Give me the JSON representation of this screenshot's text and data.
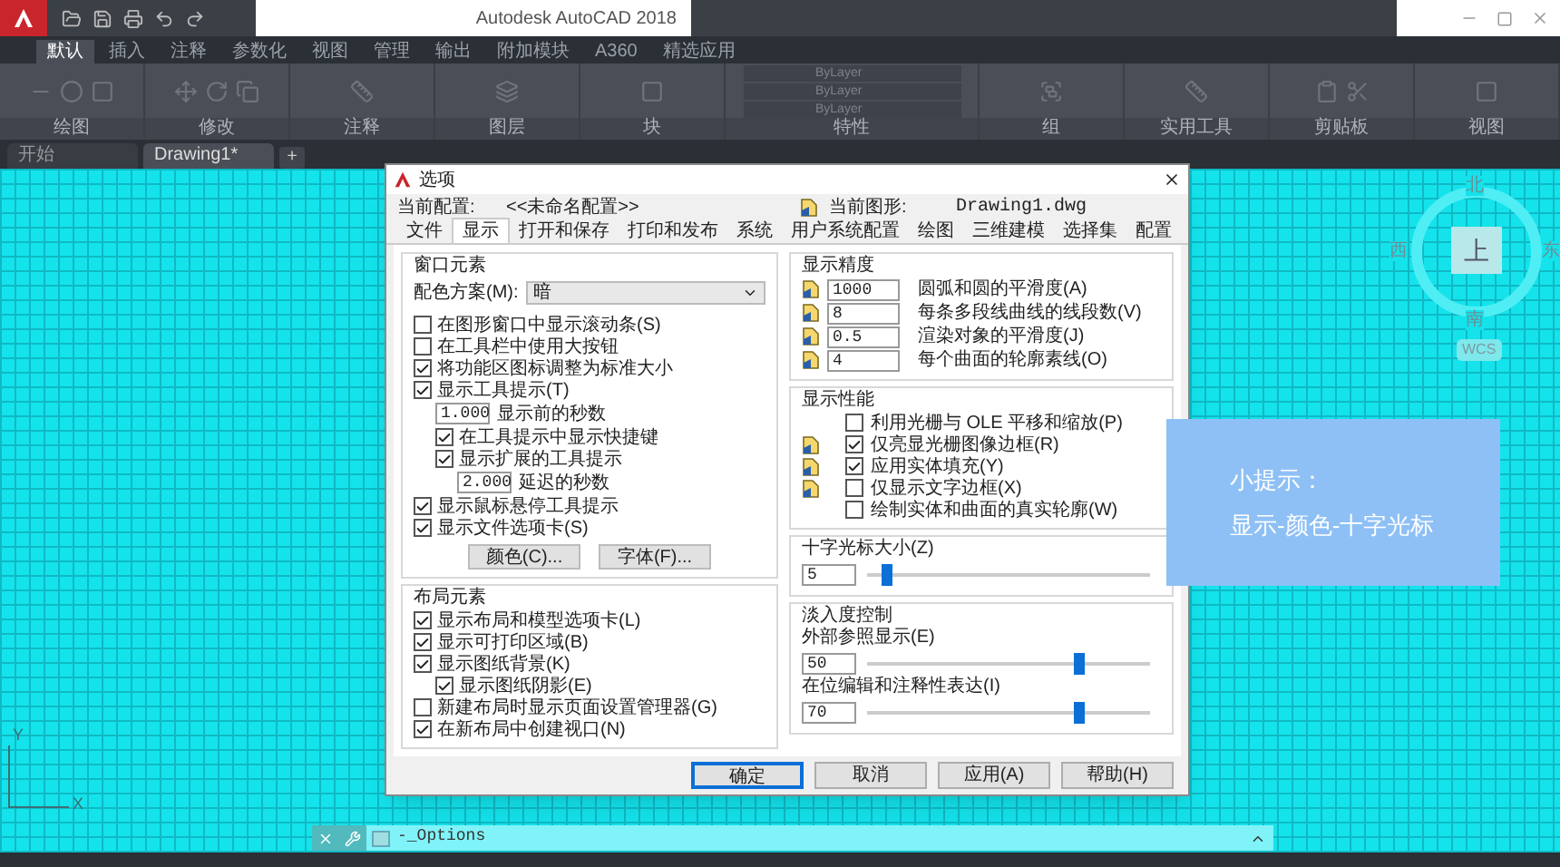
{
  "app": {
    "title": "Autodesk AutoCAD 2018"
  },
  "ribbon_tabs": [
    {
      "label": "默认",
      "selected": true
    },
    {
      "label": "插入",
      "selected": false
    },
    {
      "label": "注释",
      "selected": false
    },
    {
      "label": "参数化",
      "selected": false
    },
    {
      "label": "视图",
      "selected": false
    },
    {
      "label": "管理",
      "selected": false
    },
    {
      "label": "输出",
      "selected": false
    },
    {
      "label": "附加模块",
      "selected": false
    },
    {
      "label": "A360",
      "selected": false
    },
    {
      "label": "精选应用",
      "selected": false
    }
  ],
  "ribbon_panels": [
    {
      "label": "绘图"
    },
    {
      "label": "修改"
    },
    {
      "label": "注释"
    },
    {
      "label": "图层"
    },
    {
      "label": "块"
    },
    {
      "label": "特性",
      "dropdowns": [
        "ByLayer",
        "ByLayer",
        "ByLayer"
      ]
    },
    {
      "label": "组"
    },
    {
      "label": "实用工具"
    },
    {
      "label": "剪贴板"
    },
    {
      "label": "视图"
    }
  ],
  "document_tabs": [
    {
      "label": "开始",
      "selected": false
    },
    {
      "label": "Drawing1*",
      "selected": true
    }
  ],
  "new_tab_button": "+",
  "dialog": {
    "title": "选项",
    "profile_label": "当前配置:",
    "profile": "<<未命名配置>>",
    "drawing_label": "当前图形:",
    "drawing": "Drawing1.dwg",
    "tabs": [
      {
        "label": "文件",
        "selected": false
      },
      {
        "label": "显示",
        "selected": true
      },
      {
        "label": "打开和保存",
        "selected": false
      },
      {
        "label": "打印和发布",
        "selected": false
      },
      {
        "label": "系统",
        "selected": false
      },
      {
        "label": "用户系统配置",
        "selected": false
      },
      {
        "label": "绘图",
        "selected": false
      },
      {
        "label": "三维建模",
        "selected": false
      },
      {
        "label": "选择集",
        "selected": false
      },
      {
        "label": "配置",
        "selected": false
      }
    ],
    "window_elements": {
      "title": "窗口元素",
      "color_scheme_label": "配色方案(M):",
      "color_scheme": "暗",
      "options": [
        {
          "kind": "checkbox",
          "label": "在图形窗口中显示滚动条(S)",
          "checked": false
        },
        {
          "kind": "checkbox",
          "label": "在工具栏中使用大按钮",
          "checked": false
        },
        {
          "kind": "checkbox",
          "label": "将功能区图标调整为标准大小",
          "checked": true
        },
        {
          "kind": "checkbox",
          "label": "显示工具提示(T)",
          "checked": true,
          "children": [
            {
              "kind": "number",
              "value": "1.000",
              "label": "显示前的秒数"
            },
            {
              "kind": "checkbox",
              "label": "在工具提示中显示快捷键",
              "checked": true
            },
            {
              "kind": "checkbox",
              "label": "显示扩展的工具提示",
              "checked": true,
              "children": [
                {
                  "kind": "number",
                  "value": "2.000",
                  "label": "延迟的秒数"
                }
              ]
            }
          ]
        },
        {
          "kind": "checkbox",
          "label": "显示鼠标悬停工具提示",
          "checked": true
        },
        {
          "kind": "checkbox",
          "label": "显示文件选项卡(S)",
          "checked": true
        }
      ],
      "buttons": [
        "颜色(C)...",
        "字体(F)..."
      ]
    },
    "layout_elements": {
      "title": "布局元素",
      "options": [
        {
          "kind": "checkbox",
          "label": "显示布局和模型选项卡(L)",
          "checked": true
        },
        {
          "kind": "checkbox",
          "label": "显示可打印区域(B)",
          "checked": true
        },
        {
          "kind": "checkbox",
          "label": "显示图纸背景(K)",
          "checked": true,
          "children": [
            {
              "kind": "checkbox",
              "label": "显示图纸阴影(E)",
              "checked": true
            }
          ]
        },
        {
          "kind": "checkbox",
          "label": "新建布局时显示页面设置管理器(G)",
          "checked": false
        },
        {
          "kind": "checkbox",
          "label": "在新布局中创建视口(N)",
          "checked": true
        }
      ]
    },
    "display_resolution": {
      "title": "显示精度",
      "rows": [
        {
          "value": "1000",
          "label": "圆弧和圆的平滑度(A)",
          "saved_in_drawing": true
        },
        {
          "value": "8",
          "label": "每条多段线曲线的线段数(V)",
          "saved_in_drawing": true
        },
        {
          "value": "0.5",
          "label": "渲染对象的平滑度(J)",
          "saved_in_drawing": true
        },
        {
          "value": "4",
          "label": "每个曲面的轮廓素线(O)",
          "saved_in_drawing": true
        }
      ]
    },
    "display_performance": {
      "title": "显示性能",
      "options": [
        {
          "label": "利用光栅与 OLE 平移和缩放(P)",
          "checked": false,
          "saved_in_drawing": false
        },
        {
          "label": "仅亮显光栅图像边框(R)",
          "checked": true,
          "saved_in_drawing": true
        },
        {
          "label": "应用实体填充(Y)",
          "checked": true,
          "saved_in_drawing": true
        },
        {
          "label": "仅显示文字边框(X)",
          "checked": false,
          "saved_in_drawing": true
        },
        {
          "label": "绘制实体和曲面的真实轮廓(W)",
          "checked": false,
          "saved_in_drawing": false
        }
      ]
    },
    "crosshair": {
      "title": "十字光标大小(Z)",
      "value": "5",
      "level": 0.07
    },
    "fade_control": {
      "title": "淡入度控制",
      "sliders": [
        {
          "label": "外部参照显示(E)",
          "value": "50",
          "level": 0.75
        },
        {
          "label": "在位编辑和注释性表达(I)",
          "value": "70",
          "level": 0.75
        }
      ]
    },
    "footer_buttons": [
      {
        "label": "确定",
        "default": true
      },
      {
        "label": "取消",
        "default": false
      },
      {
        "label": "应用(A)",
        "default": false
      },
      {
        "label": "帮助(H)",
        "default": false
      }
    ]
  },
  "viewcube": {
    "top": "上",
    "north": "北",
    "south": "南",
    "east": "东",
    "west": "西",
    "ucs": "WCS"
  },
  "tip": {
    "title": "小提示：",
    "text": "显示-颜色-十字光标"
  },
  "ucs_icon": {
    "x": "X",
    "y": "Y"
  },
  "command_line": {
    "text": "-_Options"
  }
}
